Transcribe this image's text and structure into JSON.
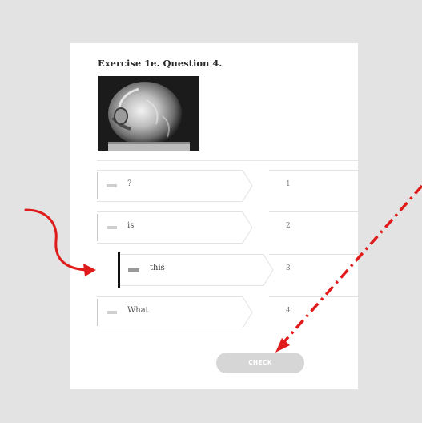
{
  "exercise": {
    "title": "Exercise 1e. Question 4.",
    "check_label": "CHECK"
  },
  "rows": [
    {
      "word": "?",
      "number": "1",
      "active": false
    },
    {
      "word": "is",
      "number": "2",
      "active": false
    },
    {
      "word": "this",
      "number": "3",
      "active": true
    },
    {
      "word": "What",
      "number": "4",
      "active": false
    }
  ],
  "icons": {
    "drag_handle": "grip-lines-icon"
  },
  "colors": {
    "page_background": "#e3e3e3",
    "card_background": "#ffffff",
    "active_bar": "#111111",
    "annotation_arrow": "#e01b1b",
    "check_button": "#d6d6d6"
  }
}
